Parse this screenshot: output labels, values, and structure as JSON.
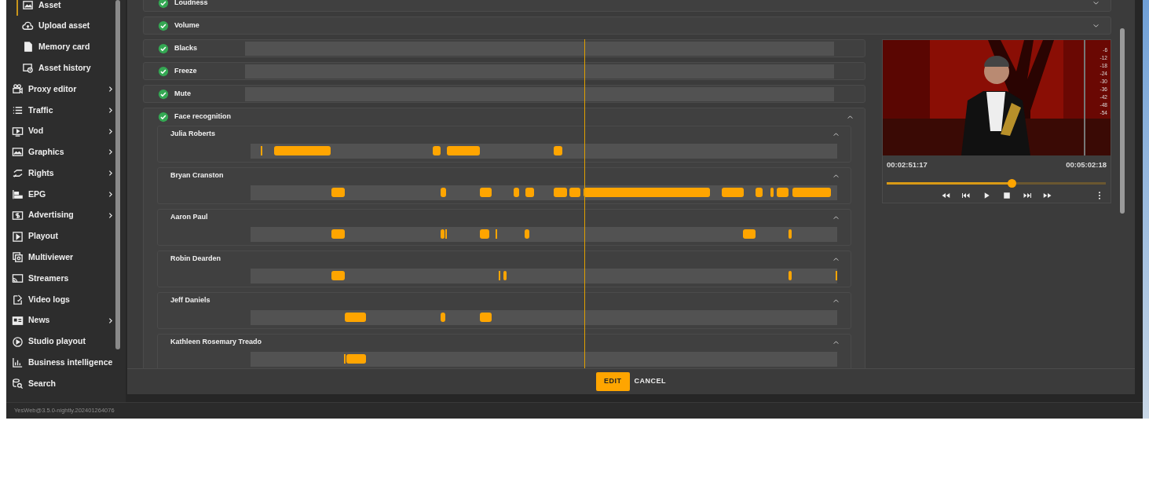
{
  "sidebar": {
    "sub_items": [
      {
        "label": "Asset",
        "selected": true
      },
      {
        "label": "Upload asset",
        "selected": false
      },
      {
        "label": "Memory card",
        "selected": false
      },
      {
        "label": "Asset history",
        "selected": false
      }
    ],
    "items": [
      {
        "label": "Proxy editor",
        "expandable": true
      },
      {
        "label": "Traffic",
        "expandable": true
      },
      {
        "label": "Vod",
        "expandable": true
      },
      {
        "label": "Graphics",
        "expandable": true
      },
      {
        "label": "Rights",
        "expandable": true
      },
      {
        "label": "EPG",
        "expandable": true
      },
      {
        "label": "Advertising",
        "expandable": true
      },
      {
        "label": "Playout",
        "expandable": false
      },
      {
        "label": "Multiviewer",
        "expandable": false
      },
      {
        "label": "Streamers",
        "expandable": false
      },
      {
        "label": "Video logs",
        "expandable": false
      },
      {
        "label": "News",
        "expandable": true
      },
      {
        "label": "Studio playout",
        "expandable": false
      },
      {
        "label": "Business intelligence",
        "expandable": false
      },
      {
        "label": "Search",
        "expandable": false
      }
    ]
  },
  "checks_top": [
    {
      "label": "Loudness",
      "passed": true,
      "expanded": false
    },
    {
      "label": "Volume",
      "passed": true,
      "expanded": false
    }
  ],
  "checks": [
    {
      "label": "Blacks",
      "passed": true
    },
    {
      "label": "Freeze",
      "passed": true
    },
    {
      "label": "Mute",
      "passed": true
    }
  ],
  "face_recognition": {
    "label": "Face recognition",
    "passed": true,
    "expanded": true,
    "faces": [
      {
        "name": "Julia Roberts",
        "expanded": true
      },
      {
        "name": "Bryan Cranston",
        "expanded": true
      },
      {
        "name": "Aaron Paul",
        "expanded": true
      },
      {
        "name": "Robin Dearden",
        "expanded": true
      },
      {
        "name": "Jeff Daniels",
        "expanded": true
      },
      {
        "name": "Kathleen Rosemary Treado",
        "expanded": true
      }
    ]
  },
  "player": {
    "meter_labels": [
      "-6",
      "-12",
      "-18",
      "-24",
      "-30",
      "-36",
      "-42",
      "-48",
      "-54"
    ],
    "current_time": "00:02:51:17",
    "duration": "00:05:02:18",
    "position": {
      "level": 0.57
    }
  },
  "actions": {
    "edit": "EDIT",
    "cancel": "CANCEL"
  },
  "footer": {
    "version": "YesWeb@3.5.0-nightly.202401264076"
  }
}
